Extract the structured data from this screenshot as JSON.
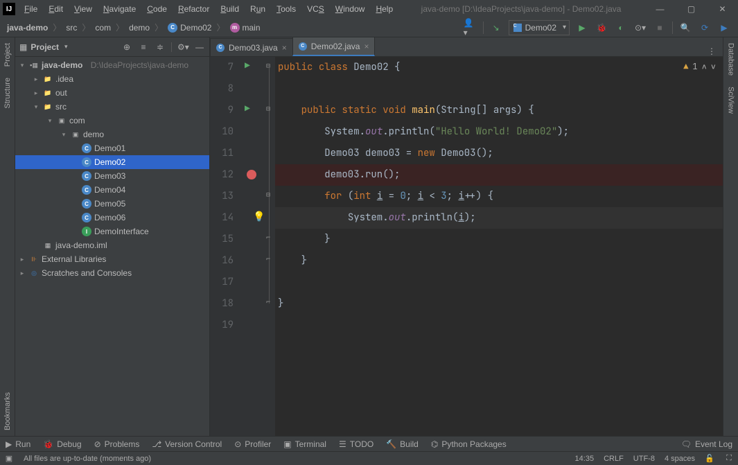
{
  "title": "java-demo [D:\\IdeaProjects\\java-demo] - Demo02.java",
  "menu": [
    "File",
    "Edit",
    "View",
    "Navigate",
    "Code",
    "Refactor",
    "Build",
    "Run",
    "Tools",
    "VCS",
    "Window",
    "Help"
  ],
  "breadcrumb": {
    "project": "java-demo",
    "src": "src",
    "pkg1": "com",
    "pkg2": "demo",
    "cls": "Demo02",
    "meth": "main"
  },
  "run_config": "Demo02",
  "left_tabs": {
    "project": "Project",
    "structure": "Structure",
    "bookmarks": "Bookmarks"
  },
  "right_tabs": {
    "database": "Database",
    "sciview": "SciView"
  },
  "project_pane": {
    "title": "Project",
    "root": {
      "name": "java-demo",
      "path": "D:\\IdeaProjects\\java-demo"
    },
    "idea": ".idea",
    "out": "out",
    "src": "src",
    "com": "com",
    "demo": "demo",
    "classes": [
      "Demo01",
      "Demo02",
      "Demo03",
      "Demo04",
      "Demo05",
      "Demo06"
    ],
    "iface": "DemoInterface",
    "iml": "java-demo.iml",
    "ext": "External Libraries",
    "scratch": "Scratches and Consoles"
  },
  "tabs": [
    {
      "name": "Demo03.java",
      "active": false
    },
    {
      "name": "Demo02.java",
      "active": true
    }
  ],
  "inspection": {
    "warnings": "1"
  },
  "line_start": 7,
  "code": {
    "l7a": "public",
    "l7b": "class",
    "l7c": "Demo02",
    "l7d": " {",
    "l9a": "public",
    "l9b": "static",
    "l9c": "void",
    "l9d": "main",
    "l9e": "(String[] args) {",
    "l10a": "System.",
    "l10b": "out",
    "l10c": ".println(",
    "l10d": "\"Hello World! Demo02\"",
    "l10e": ");",
    "l11a": "Demo03 demo03 = ",
    "l11b": "new",
    "l11c": " Demo03();",
    "l12": "demo03.run();",
    "l13a": "for",
    "l13b": " (",
    "l13c": "int",
    "l13d": "i",
    "l13e": " = ",
    "l13f": "0",
    "l13g": "; ",
    "l13h": "i",
    "l13i": " < ",
    "l13j": "3",
    "l13k": "; ",
    "l13l": "i",
    "l13m": "++) {",
    "l14a": "System.",
    "l14b": "out",
    "l14c": ".println(",
    "l14d": "i",
    "l14e": ");",
    "l15": "}",
    "l16": "}",
    "l18": "}"
  },
  "tools": {
    "run": "Run",
    "debug": "Debug",
    "problems": "Problems",
    "vcs": "Version Control",
    "profiler": "Profiler",
    "terminal": "Terminal",
    "todo": "TODO",
    "build": "Build",
    "python": "Python Packages",
    "eventlog": "Event Log"
  },
  "status": {
    "msg": "All files are up-to-date (moments ago)",
    "pos": "14:35",
    "eol": "CRLF",
    "enc": "UTF-8",
    "indent": "4 spaces"
  }
}
